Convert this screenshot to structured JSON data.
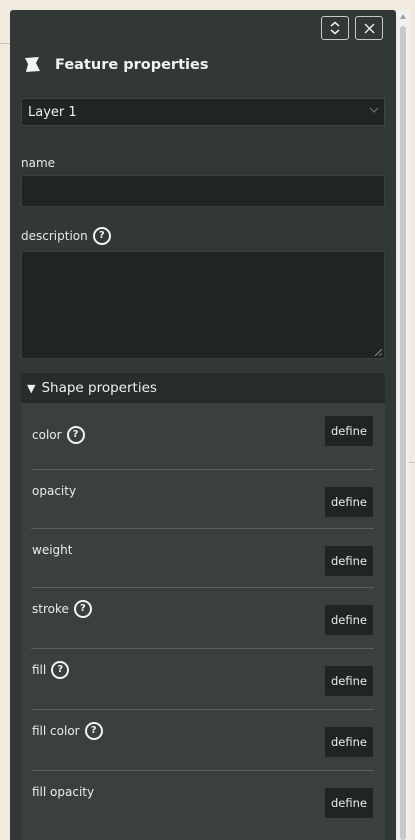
{
  "panel": {
    "title": "Feature properties",
    "layer_select": {
      "value": "Layer 1"
    },
    "fields": {
      "name_label": "name",
      "description_label": "description",
      "name_value": "",
      "description_value": ""
    }
  },
  "shape_properties": {
    "header": "Shape properties",
    "rows": [
      {
        "label": "color",
        "has_help": true,
        "button": "define"
      },
      {
        "label": "opacity",
        "has_help": false,
        "button": "define"
      },
      {
        "label": "weight",
        "has_help": false,
        "button": "define"
      },
      {
        "label": "stroke",
        "has_help": true,
        "button": "define"
      },
      {
        "label": "fill",
        "has_help": true,
        "button": "define"
      },
      {
        "label": "fill color",
        "has_help": true,
        "button": "define"
      },
      {
        "label": "fill opacity",
        "has_help": false,
        "button": "define"
      }
    ]
  },
  "colors": {
    "panel_bg": "#323737",
    "input_bg": "#202425",
    "fieldset_bg": "#3a4040",
    "map_bg": "#f1ebde"
  }
}
